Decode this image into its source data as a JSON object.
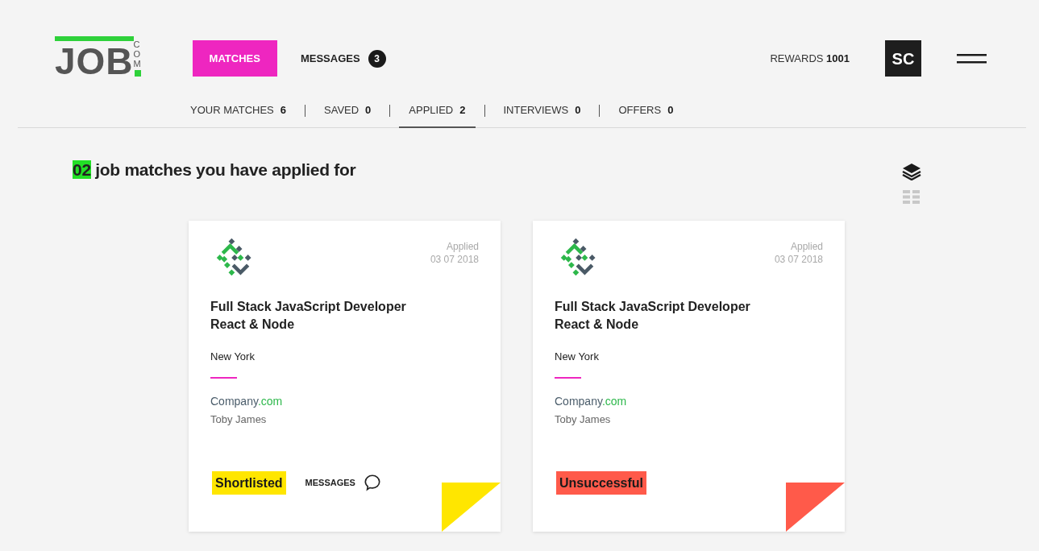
{
  "logo": {
    "main": "JOB",
    "suffix": "COM"
  },
  "nav": [
    {
      "label": "MATCHES",
      "selected": true
    },
    {
      "label": "MESSAGES",
      "selected": false,
      "badge": "3"
    }
  ],
  "rewards": {
    "label": "REWARDS",
    "value": "1001"
  },
  "avatar": {
    "initials": "SC"
  },
  "tabs": [
    {
      "label": "YOUR MATCHES",
      "count": "6",
      "selected": false
    },
    {
      "label": "SAVED",
      "count": "0",
      "selected": false
    },
    {
      "label": "APPLIED",
      "count": "2",
      "selected": true
    },
    {
      "label": "INTERVIEWS",
      "count": "0",
      "selected": false
    },
    {
      "label": "OFFERS",
      "count": "0",
      "selected": false
    }
  ],
  "heading": {
    "count": "02",
    "text": "job matches you have applied for"
  },
  "view_toggle": [
    {
      "kind": "stack",
      "selected": true
    },
    {
      "kind": "grid",
      "selected": false
    }
  ],
  "cards": [
    {
      "applied_label": "Applied",
      "applied_date": "03 07 2018",
      "title": [
        "Full Stack JavaScript Developer",
        "React & Node"
      ],
      "location": "New York",
      "company": "Company",
      "company_domain": ".com",
      "contact": "Toby James",
      "status": {
        "label": "Shortlisted",
        "color": "#ffe600"
      },
      "messages_link": "MESSAGES"
    },
    {
      "applied_label": "Applied",
      "applied_date": "03 07 2018",
      "title": [
        "Full Stack JavaScript Developer",
        "React & Node"
      ],
      "location": "New York",
      "company": "Company",
      "company_domain": ".com",
      "contact": "Toby James",
      "status": {
        "label": "Unsuccessful",
        "color": "#ff5a4a"
      }
    }
  ]
}
